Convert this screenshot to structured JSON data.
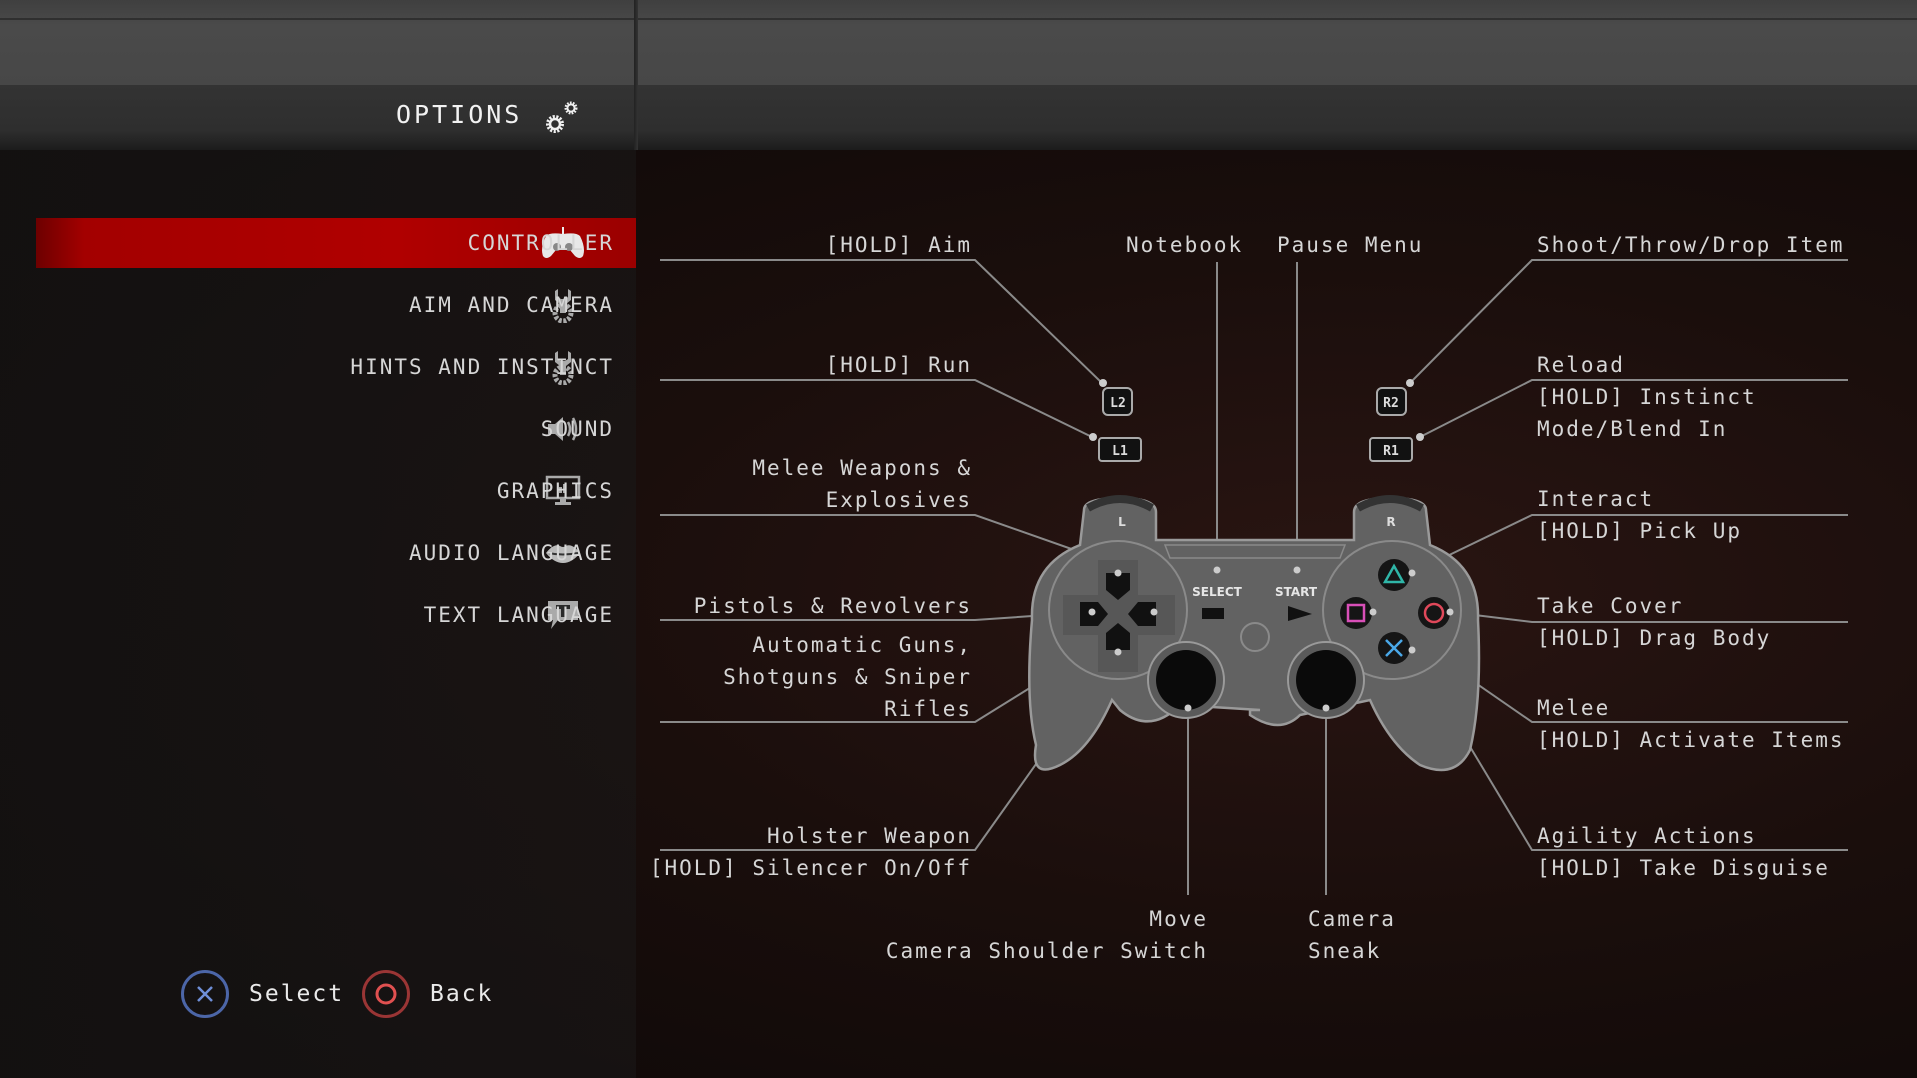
{
  "header": {
    "title": "OPTIONS",
    "icon": "gears-icon"
  },
  "menu": {
    "items": [
      {
        "label": "CONTROLLER",
        "icon": "gamepad-icon",
        "active": true
      },
      {
        "label": "AIM AND CAMERA",
        "icon": "wrench-gear-icon",
        "active": false
      },
      {
        "label": "HINTS AND INSTINCT",
        "icon": "wrench-gear-icon",
        "active": false
      },
      {
        "label": "SOUND",
        "icon": "speaker-icon",
        "active": false
      },
      {
        "label": "GRAPHICS",
        "icon": "monitor-icon",
        "active": false
      },
      {
        "label": "AUDIO LANGUAGE",
        "icon": "lips-icon",
        "active": false
      },
      {
        "label": "TEXT LANGUAGE",
        "icon": "speech-bubble-t-icon",
        "active": false
      }
    ]
  },
  "footer": {
    "select": {
      "label": "Select",
      "glyph": "cross-button-icon",
      "color": "#5b7fd6"
    },
    "back": {
      "label": "Back",
      "glyph": "circle-button-icon",
      "color": "#d84a4a"
    }
  },
  "controller": {
    "buttons": {
      "l2": "L2",
      "l1": "L1",
      "r2": "R2",
      "r1": "R1",
      "l": "L",
      "r": "R",
      "select": "SELECT",
      "start": "START"
    },
    "face_colors": {
      "triangle": "#2fb6a8",
      "circle": "#e0485a",
      "cross": "#4aa8e8",
      "square": "#d94fb8"
    },
    "mappings": {
      "l2": [
        "[HOLD] Aim"
      ],
      "l1": [
        "[HOLD] Run"
      ],
      "dpad_up": [
        "Melee Weapons &",
        "Explosives"
      ],
      "dpad_left": [
        "Pistols & Revolvers"
      ],
      "dpad_right": [
        "Automatic Guns,",
        "Shotguns & Sniper",
        "Rifles"
      ],
      "dpad_down": [
        "Holster Weapon",
        "[HOLD] Silencer On/Off"
      ],
      "select": [
        "Notebook"
      ],
      "start": [
        "Pause Menu"
      ],
      "r2": [
        "Shoot/Throw/Drop Item"
      ],
      "r1": [
        "Reload",
        "[HOLD] Instinct",
        "Mode/Blend In"
      ],
      "triangle": [
        "Interact",
        "[HOLD] Pick Up"
      ],
      "circle": [
        "Take Cover",
        "[HOLD] Drag Body"
      ],
      "square": [
        "Melee",
        "[HOLD] Activate Items"
      ],
      "cross": [
        "Agility Actions",
        "[HOLD] Take Disguise"
      ],
      "left_stick": [
        "Move",
        "Camera Shoulder Switch"
      ],
      "right_stick": [
        "Camera",
        "Sneak"
      ]
    }
  }
}
